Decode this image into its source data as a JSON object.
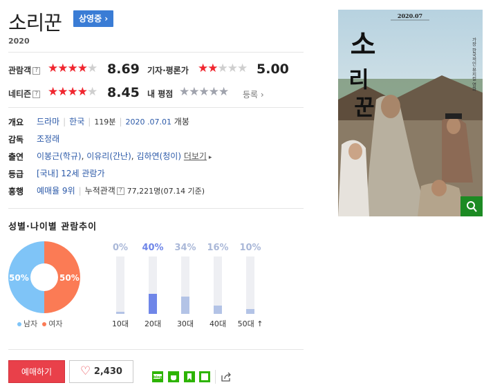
{
  "movie": {
    "title": "소리꾼",
    "status_badge": "상영중 ›",
    "year": "2020"
  },
  "ratings": {
    "audience_label": "관람객",
    "audience_score": "8.69",
    "audience_stars": 4.5,
    "critic_label": "기자·평론가",
    "critic_score": "5.00",
    "critic_stars": 2.5,
    "netizen_label": "네티즌",
    "netizen_score": "8.45",
    "netizen_stars": 4.5,
    "my_rating_label": "내 평점",
    "register_label": "등록 ›",
    "help_mark": "?"
  },
  "info": {
    "overview_label": "개요",
    "genre": "드라마",
    "country": "한국",
    "runtime": "119분",
    "release_date": "2020 .07.01",
    "release_suffix": "개봉",
    "director_label": "감독",
    "director": "조정래",
    "cast_label": "출연",
    "cast_1": "이봉근(학규)",
    "cast_2": "이유리(간난)",
    "cast_3": "김하연(청이)",
    "cast_more": "더보기",
    "rating_label": "등급",
    "rating_value": "[국내] 12세 관람가",
    "box_label": "흥행",
    "reservation_rank": "예매율 9위",
    "cumulative_label": "누적관객",
    "cumulative_value": "77,221명",
    "cumulative_date": "(07.14 기준)"
  },
  "demographics": {
    "title": "성별·나이별 관람추이",
    "gender": {
      "male_pct": "50%",
      "female_pct": "50%",
      "male_label": "남자",
      "female_label": "여자",
      "male_color": "#7fc4f7",
      "female_color": "#fb7b55"
    },
    "ages": [
      {
        "pct": "0%",
        "label": "10대",
        "value": 0,
        "highlight": false
      },
      {
        "pct": "40%",
        "label": "20대",
        "value": 40,
        "highlight": true
      },
      {
        "pct": "34%",
        "label": "30대",
        "value": 34,
        "highlight": false
      },
      {
        "pct": "16%",
        "label": "40대",
        "value": 16,
        "highlight": false
      },
      {
        "pct": "10%",
        "label": "50대 ↑",
        "value": 10,
        "highlight": false
      }
    ]
  },
  "actions": {
    "reserve_label": "예매하기",
    "like_count": "2,430"
  },
  "poster": {
    "date_text": "2020.07",
    "title_glyphs": [
      "소",
      "리",
      "꾼"
    ],
    "side_text": "가장 한국적인 뮤지컬 영화"
  }
}
